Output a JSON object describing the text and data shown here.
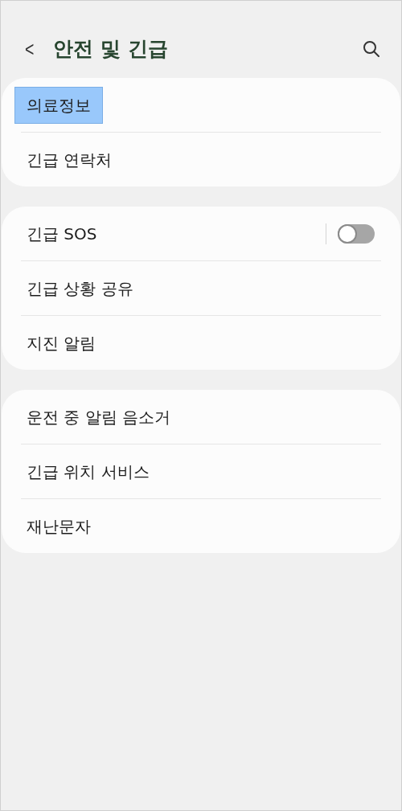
{
  "header": {
    "back": "<",
    "title": "안전 및 긴급"
  },
  "groups": [
    {
      "items": [
        {
          "kind": "link",
          "label": "의료정보",
          "highlighted": true
        },
        {
          "kind": "link",
          "label": "긴급 연락처",
          "highlighted": false
        }
      ]
    },
    {
      "items": [
        {
          "kind": "toggle",
          "label": "긴급 SOS",
          "on": false,
          "highlighted": false
        },
        {
          "kind": "link",
          "label": "긴급 상황 공유",
          "highlighted": false
        },
        {
          "kind": "link",
          "label": "지진 알림",
          "highlighted": false
        }
      ]
    },
    {
      "items": [
        {
          "kind": "link",
          "label": "운전 중 알림 음소거",
          "highlighted": false
        },
        {
          "kind": "link",
          "label": "긴급 위치 서비스",
          "highlighted": false
        },
        {
          "kind": "link",
          "label": "재난문자",
          "highlighted": false
        }
      ]
    }
  ]
}
